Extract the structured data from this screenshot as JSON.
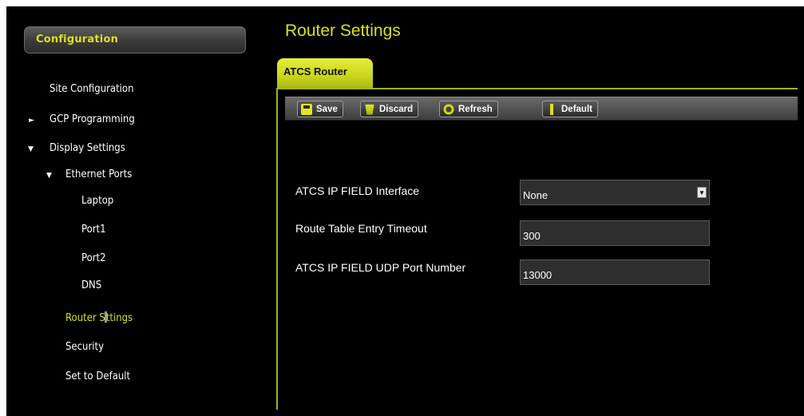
{
  "sidebar": {
    "header": "Configuration",
    "items": [
      {
        "label": "Site Configuration"
      },
      {
        "label": "GCP Programming",
        "arrow": "►"
      },
      {
        "label": "Display Settings",
        "arrow": "▼"
      },
      {
        "label": "Ethernet Ports",
        "arrow": "▼"
      },
      {
        "label": "Laptop"
      },
      {
        "label": "Port1"
      },
      {
        "label": "Port2"
      },
      {
        "label": "DNS"
      },
      {
        "label_pre": "Router S",
        "label_post": "ttings"
      },
      {
        "label": "Security"
      },
      {
        "label": "Set to Default"
      }
    ]
  },
  "main": {
    "title": "Router Settings",
    "tab": "ATCS Router",
    "toolbar": {
      "save": "Save",
      "discard": "Discard",
      "refresh": "Refresh",
      "default": "Default"
    },
    "fields": [
      {
        "label": "ATCS IP FIELD Interface",
        "value": "None"
      },
      {
        "label": "Route Table Entry Timeout",
        "value": "300"
      },
      {
        "label": "ATCS IP FIELD UDP Port Number",
        "value": "13000"
      }
    ]
  },
  "colors": {
    "accent": "#d9e021",
    "background": "#000000"
  }
}
